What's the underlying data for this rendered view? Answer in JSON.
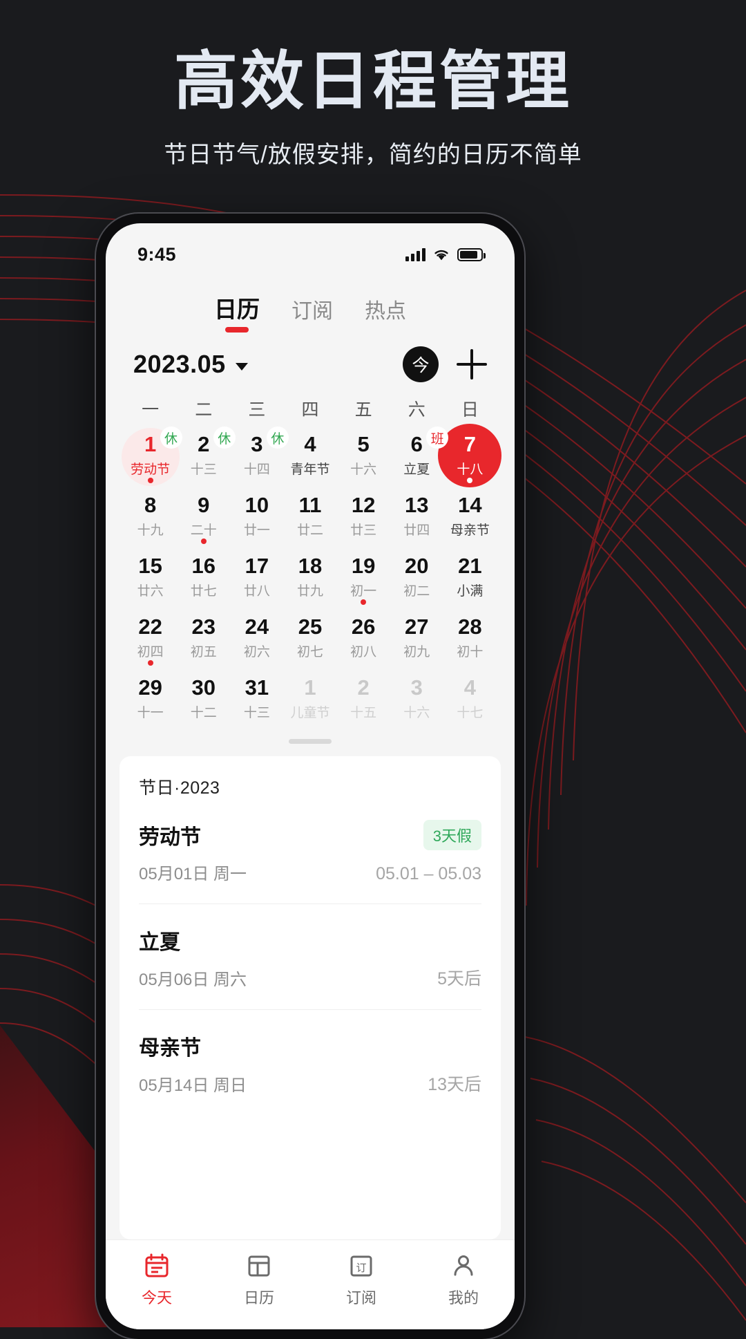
{
  "promo": {
    "title": "高效日程管理",
    "subtitle": "节日节气/放假安排，简约的日历不简单"
  },
  "colors": {
    "accent": "#e8272c",
    "rest_badge": "#34a853",
    "work_badge": "#e8272c",
    "page_bg": "#1a1b1e",
    "title_text": "#e3e9f2"
  },
  "statusbar": {
    "time": "9:45"
  },
  "top_tabs": [
    {
      "label": "日历",
      "active": true
    },
    {
      "label": "订阅",
      "active": false
    },
    {
      "label": "热点",
      "active": false
    }
  ],
  "month_header": {
    "title": "2023.05",
    "caret": "chevron-down-icon",
    "today_label": "今",
    "add_label": "+"
  },
  "calendar": {
    "weekdays": [
      "一",
      "二",
      "三",
      "四",
      "五",
      "六",
      "日"
    ],
    "days": [
      {
        "num": "1",
        "sub": "劳动节",
        "badge": "休",
        "badge_type": "rest",
        "holiday": true,
        "halo": true,
        "dot": true
      },
      {
        "num": "2",
        "sub": "十三",
        "badge": "休",
        "badge_type": "rest"
      },
      {
        "num": "3",
        "sub": "十四",
        "badge": "休",
        "badge_type": "rest"
      },
      {
        "num": "4",
        "sub": "青年节",
        "festival": true
      },
      {
        "num": "5",
        "sub": "十六"
      },
      {
        "num": "6",
        "sub": "立夏",
        "badge": "班",
        "badge_type": "work",
        "festival": true
      },
      {
        "num": "7",
        "sub": "十八",
        "selected": true,
        "dot": true
      },
      {
        "num": "8",
        "sub": "十九"
      },
      {
        "num": "9",
        "sub": "二十",
        "dot": true
      },
      {
        "num": "10",
        "sub": "廿一"
      },
      {
        "num": "11",
        "sub": "廿二"
      },
      {
        "num": "12",
        "sub": "廿三"
      },
      {
        "num": "13",
        "sub": "廿四"
      },
      {
        "num": "14",
        "sub": "母亲节",
        "festival": true
      },
      {
        "num": "15",
        "sub": "廿六"
      },
      {
        "num": "16",
        "sub": "廿七"
      },
      {
        "num": "17",
        "sub": "廿八"
      },
      {
        "num": "18",
        "sub": "廿九"
      },
      {
        "num": "19",
        "sub": "初一",
        "dot": true
      },
      {
        "num": "20",
        "sub": "初二"
      },
      {
        "num": "21",
        "sub": "小满",
        "festival": true
      },
      {
        "num": "22",
        "sub": "初四",
        "dot": true
      },
      {
        "num": "23",
        "sub": "初五"
      },
      {
        "num": "24",
        "sub": "初六"
      },
      {
        "num": "25",
        "sub": "初七"
      },
      {
        "num": "26",
        "sub": "初八"
      },
      {
        "num": "27",
        "sub": "初九"
      },
      {
        "num": "28",
        "sub": "初十"
      },
      {
        "num": "29",
        "sub": "十一"
      },
      {
        "num": "30",
        "sub": "十二"
      },
      {
        "num": "31",
        "sub": "十三"
      },
      {
        "num": "1",
        "sub": "儿童节",
        "outside": true
      },
      {
        "num": "2",
        "sub": "十五",
        "outside": true
      },
      {
        "num": "3",
        "sub": "十六",
        "outside": true
      },
      {
        "num": "4",
        "sub": "十七",
        "outside": true
      }
    ]
  },
  "event_card": {
    "title": "节日·2023",
    "events": [
      {
        "name": "劳动节",
        "tag": "3天假",
        "date": "05月01日 周一",
        "right": "05.01 – 05.03"
      },
      {
        "name": "立夏",
        "tag": "",
        "date": "05月06日 周六",
        "right": "5天后"
      },
      {
        "name": "母亲节",
        "tag": "",
        "date": "05月14日 周日",
        "right": "13天后"
      }
    ]
  },
  "bottom_nav": [
    {
      "label": "今天",
      "icon": "calendar-today-icon",
      "active": true
    },
    {
      "label": "日历",
      "icon": "calendar-grid-icon",
      "active": false
    },
    {
      "label": "订阅",
      "icon": "subscribe-icon",
      "active": false
    },
    {
      "label": "我的",
      "icon": "user-profile-icon",
      "active": false
    }
  ]
}
